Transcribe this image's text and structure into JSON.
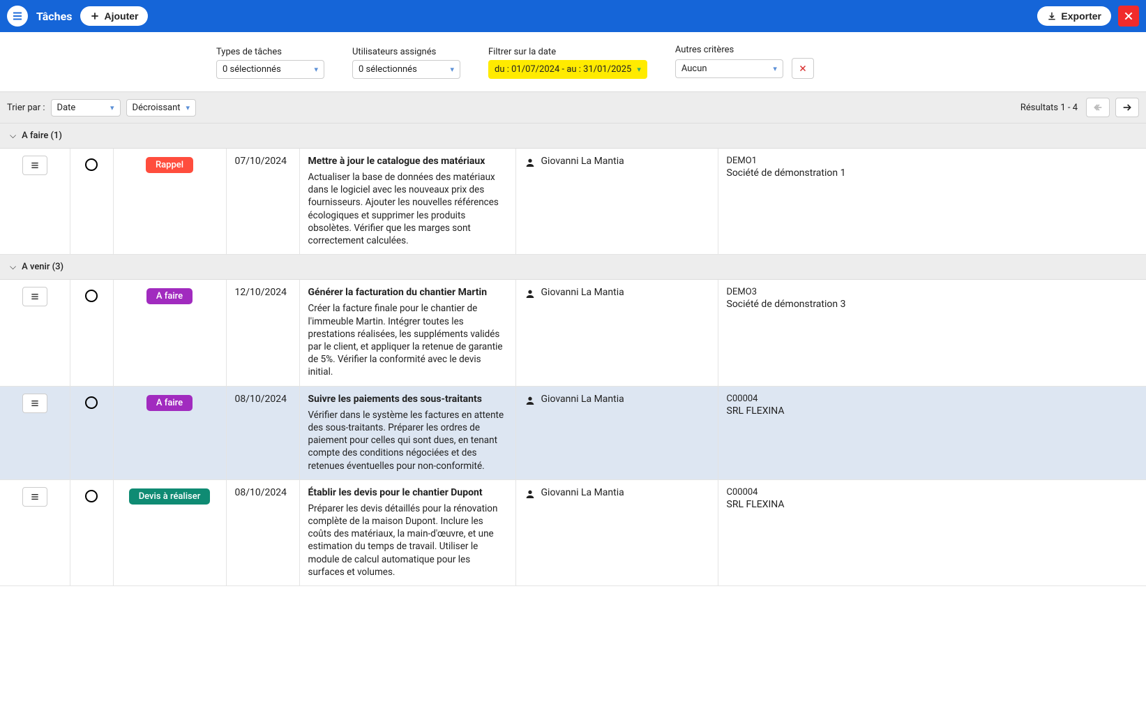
{
  "header": {
    "title": "Tâches",
    "add_label": "Ajouter",
    "export_label": "Exporter"
  },
  "filters": {
    "task_types": {
      "label": "Types de tâches",
      "value": "0 sélectionnés"
    },
    "assigned_users": {
      "label": "Utilisateurs assignés",
      "value": "0 sélectionnés"
    },
    "date_filter": {
      "label": "Filtrer sur la date",
      "value": "du : 01/07/2024 - au : 31/01/2025"
    },
    "other_criteria": {
      "label": "Autres critères",
      "value": "Aucun"
    }
  },
  "sort": {
    "label": "Trier par :",
    "field": "Date",
    "direction": "Décroissant",
    "results": "Résultats 1 - 4"
  },
  "groups": [
    {
      "key": "todo",
      "label": "A faire (1)"
    },
    {
      "key": "upcoming",
      "label": "A venir (3)"
    }
  ],
  "tasks_todo": [
    {
      "tag_label": "Rappel",
      "tag_color": "red",
      "date": "07/10/2024",
      "title": "Mettre à jour le catalogue des matériaux",
      "desc": "Actualiser la base de données des matériaux dans le logiciel avec les nouveaux prix des fournisseurs. Ajouter les nouvelles références écologiques et supprimer les produits obsolètes. Vérifier que les marges sont correctement calculées.",
      "user": "Giovanni La Mantia",
      "client_code": "DEMO1",
      "client_name": "Société de démonstration 1",
      "highlight": false
    }
  ],
  "tasks_upcoming": [
    {
      "tag_label": "A faire",
      "tag_color": "purple",
      "date": "12/10/2024",
      "title": "Générer la facturation du chantier Martin",
      "desc": "Créer la facture finale pour le chantier de l'immeuble Martin. Intégrer toutes les prestations réalisées, les suppléments validés par le client, et appliquer la retenue de garantie de 5%. Vérifier la conformité avec le devis initial.",
      "user": "Giovanni La Mantia",
      "client_code": "DEMO3",
      "client_name": "Société de démonstration 3",
      "highlight": false
    },
    {
      "tag_label": "A faire",
      "tag_color": "purple",
      "date": "08/10/2024",
      "title": "Suivre les paiements des sous-traitants",
      "desc": "Vérifier dans le système les factures en attente des sous-traitants. Préparer les ordres de paiement pour celles qui sont dues, en tenant compte des conditions négociées et des retenues éventuelles pour non-conformité.",
      "user": "Giovanni La Mantia",
      "client_code": "C00004",
      "client_name": "SRL FLEXINA",
      "highlight": true
    },
    {
      "tag_label": "Devis à réaliser",
      "tag_color": "teal",
      "date": "08/10/2024",
      "title": "Établir les devis pour le chantier Dupont",
      "desc": "Préparer les devis détaillés pour la rénovation complète de la maison Dupont. Inclure les coûts des matériaux, la main-d'œuvre, et une estimation du temps de travail. Utiliser le module de calcul automatique pour les surfaces et volumes.",
      "user": "Giovanni La Mantia",
      "client_code": "C00004",
      "client_name": "SRL FLEXINA",
      "highlight": false
    }
  ]
}
